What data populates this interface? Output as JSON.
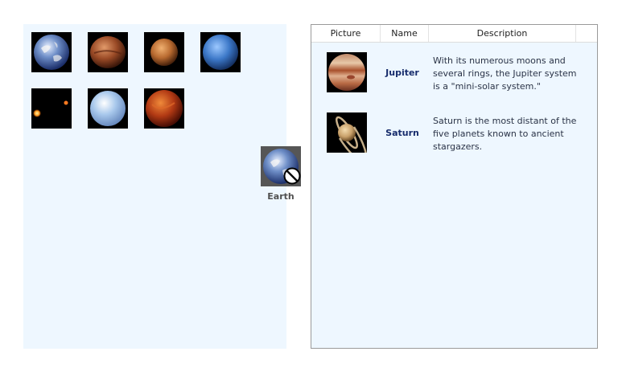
{
  "planet_gallery": {
    "items": [
      {
        "name": "Earth",
        "icon": "earth-icon"
      },
      {
        "name": "Mars",
        "icon": "mars-icon"
      },
      {
        "name": "Mercury",
        "icon": "mercury-icon"
      },
      {
        "name": "Neptune",
        "icon": "neptune-icon"
      },
      {
        "name": "Pluto",
        "icon": "pluto-icon"
      },
      {
        "name": "Uranus",
        "icon": "uranus-icon"
      },
      {
        "name": "Venus",
        "icon": "venus-icon"
      }
    ]
  },
  "drag": {
    "label": "Earth",
    "cursor_icon": "no-drop-icon"
  },
  "list": {
    "columns": [
      "Picture",
      "Name",
      "Description"
    ],
    "rows": [
      {
        "name": "Jupiter",
        "icon": "jupiter-icon",
        "description": "With its numerous moons and several rings, the Jupiter system is a \"mini-solar system.\""
      },
      {
        "name": "Saturn",
        "icon": "saturn-icon",
        "description": "Saturn is the most distant of the five planets known to ancient stargazers."
      }
    ]
  },
  "colors": {
    "panel_background": "#eef7ff",
    "name_text": "#172c6c",
    "drag_label": "#505050"
  }
}
